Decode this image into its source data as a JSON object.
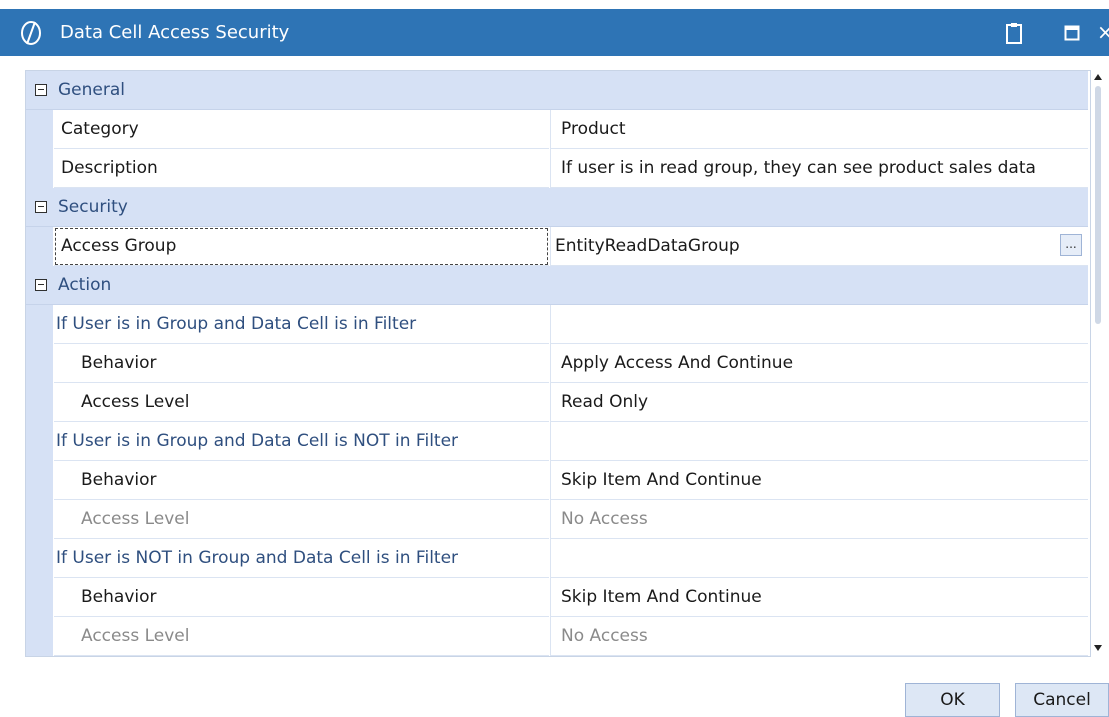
{
  "window": {
    "title": "Data Cell Access Security",
    "accent": "#2e74b5",
    "icons": {
      "logo": "onestream-logo-icon",
      "clipboard": "clipboard-icon",
      "maximize": "maximize-icon",
      "close": "close-icon"
    },
    "close_glyph": "×"
  },
  "grid": {
    "category_color": "#d6e1f5",
    "general": {
      "label": "General",
      "category_name": "Category",
      "category_value": "Product",
      "description_name": "Description",
      "description_value": "If user is in read group, they can see product sales data"
    },
    "security": {
      "label": "Security",
      "access_group_name": "Access Group",
      "access_group_value": "EntityReadDataGroup",
      "browse_label": "..."
    },
    "action": {
      "label": "Action",
      "groups": [
        {
          "heading": "If User is in Group and Data Cell is in Filter",
          "behavior_name": "Behavior",
          "behavior_value": "Apply Access And Continue",
          "level_name": "Access Level",
          "level_value": "Read Only"
        },
        {
          "heading": "If User is in Group and Data Cell is NOT in Filter",
          "behavior_name": "Behavior",
          "behavior_value": "Skip Item And Continue",
          "level_name": "Access Level",
          "level_value": "No Access"
        },
        {
          "heading": "If User is NOT in Group and Data Cell is in Filter",
          "behavior_name": "Behavior",
          "behavior_value": "Skip Item And Continue",
          "level_name": "Access Level",
          "level_value": "No Access"
        }
      ]
    }
  },
  "buttons": {
    "ok": "OK",
    "cancel": "Cancel"
  }
}
